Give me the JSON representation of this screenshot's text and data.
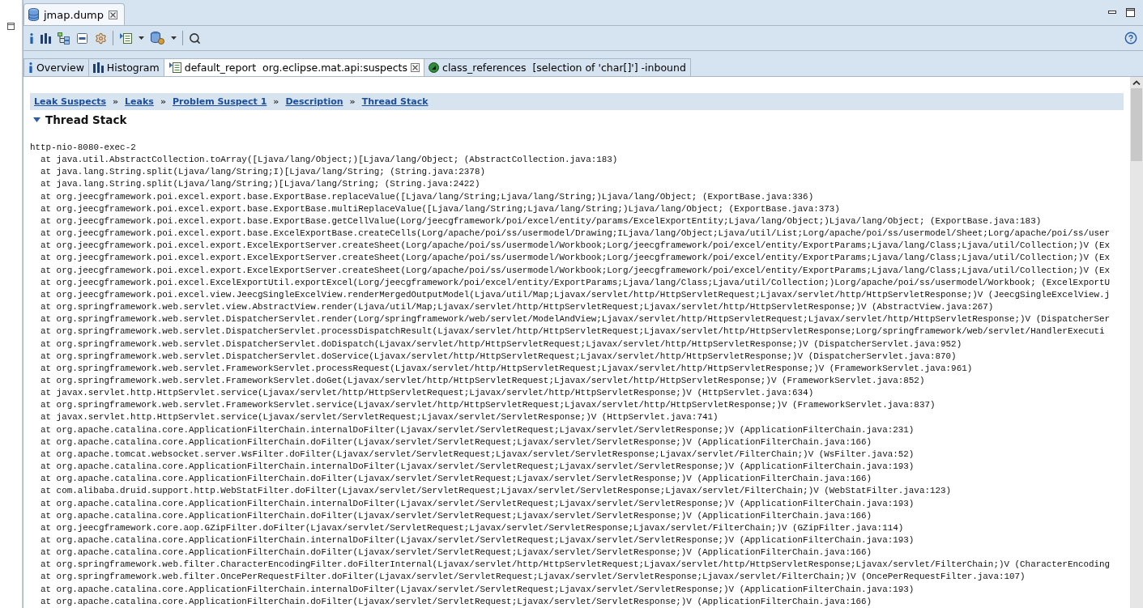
{
  "editor_tab": {
    "title": "jmap.dump",
    "selected": true
  },
  "tabs": [
    {
      "kind": "info",
      "label": "Overview",
      "selected": false,
      "closable": false
    },
    {
      "kind": "histogram",
      "label": "Histogram",
      "selected": false,
      "closable": false
    },
    {
      "kind": "report",
      "label": "default_report  org.eclipse.mat.api:suspects",
      "selected": true,
      "closable": true
    },
    {
      "kind": "query",
      "label": "class_references  [selection of 'char[]'] -inbound",
      "selected": false,
      "closable": false
    }
  ],
  "breadcrumbs": {
    "separator": "»",
    "items": [
      "Leak Suspects",
      "Leaks",
      "Problem Suspect 1",
      "Description",
      "Thread Stack"
    ]
  },
  "section": {
    "title": "Thread Stack",
    "expanded": true
  },
  "thread": {
    "name": "http-nio-8080-exec-2",
    "frames": [
      "at java.util.AbstractCollection.toArray([Ljava/lang/Object;)[Ljava/lang/Object; (AbstractCollection.java:183)",
      "at java.lang.String.split(Ljava/lang/String;I)[Ljava/lang/String; (String.java:2378)",
      "at java.lang.String.split(Ljava/lang/String;)[Ljava/lang/String; (String.java:2422)",
      "at org.jeecgframework.poi.excel.export.base.ExportBase.replaceValue([Ljava/lang/String;Ljava/lang/String;)Ljava/lang/Object; (ExportBase.java:336)",
      "at org.jeecgframework.poi.excel.export.base.ExportBase.multiReplaceValue([Ljava/lang/String;Ljava/lang/String;)Ljava/lang/Object; (ExportBase.java:373)",
      "at org.jeecgframework.poi.excel.export.base.ExportBase.getCellValue(Lorg/jeecgframework/poi/excel/entity/params/ExcelExportEntity;Ljava/lang/Object;)Ljava/lang/Object; (ExportBase.java:183)",
      "at org.jeecgframework.poi.excel.export.base.ExcelExportBase.createCells(Lorg/apache/poi/ss/usermodel/Drawing;ILjava/lang/Object;Ljava/util/List;Lorg/apache/poi/ss/usermodel/Sheet;Lorg/apache/poi/ss/user",
      "at org.jeecgframework.poi.excel.export.ExcelExportServer.createSheet(Lorg/apache/poi/ss/usermodel/Workbook;Lorg/jeecgframework/poi/excel/entity/ExportParams;Ljava/lang/Class;Ljava/util/Collection;)V (Ex",
      "at org.jeecgframework.poi.excel.export.ExcelExportServer.createSheet(Lorg/apache/poi/ss/usermodel/Workbook;Lorg/jeecgframework/poi/excel/entity/ExportParams;Ljava/lang/Class;Ljava/util/Collection;)V (Ex",
      "at org.jeecgframework.poi.excel.export.ExcelExportServer.createSheet(Lorg/apache/poi/ss/usermodel/Workbook;Lorg/jeecgframework/poi/excel/entity/ExportParams;Ljava/lang/Class;Ljava/util/Collection;)V (Ex",
      "at org.jeecgframework.poi.excel.ExcelExportUtil.exportExcel(Lorg/jeecgframework/poi/excel/entity/ExportParams;Ljava/lang/Class;Ljava/util/Collection;)Lorg/apache/poi/ss/usermodel/Workbook; (ExcelExportU",
      "at org.jeecgframework.poi.excel.view.JeecgSingleExcelView.renderMergedOutputModel(Ljava/util/Map;Ljavax/servlet/http/HttpServletRequest;Ljavax/servlet/http/HttpServletResponse;)V (JeecgSingleExcelView.j",
      "at org.springframework.web.servlet.view.AbstractView.render(Ljava/util/Map;Ljavax/servlet/http/HttpServletRequest;Ljavax/servlet/http/HttpServletResponse;)V (AbstractView.java:267)",
      "at org.springframework.web.servlet.DispatcherServlet.render(Lorg/springframework/web/servlet/ModelAndView;Ljavax/servlet/http/HttpServletRequest;Ljavax/servlet/http/HttpServletResponse;)V (DispatcherSer",
      "at org.springframework.web.servlet.DispatcherServlet.processDispatchResult(Ljavax/servlet/http/HttpServletRequest;Ljavax/servlet/http/HttpServletResponse;Lorg/springframework/web/servlet/HandlerExecuti",
      "at org.springframework.web.servlet.DispatcherServlet.doDispatch(Ljavax/servlet/http/HttpServletRequest;Ljavax/servlet/http/HttpServletResponse;)V (DispatcherServlet.java:952)",
      "at org.springframework.web.servlet.DispatcherServlet.doService(Ljavax/servlet/http/HttpServletRequest;Ljavax/servlet/http/HttpServletResponse;)V (DispatcherServlet.java:870)",
      "at org.springframework.web.servlet.FrameworkServlet.processRequest(Ljavax/servlet/http/HttpServletRequest;Ljavax/servlet/http/HttpServletResponse;)V (FrameworkServlet.java:961)",
      "at org.springframework.web.servlet.FrameworkServlet.doGet(Ljavax/servlet/http/HttpServletRequest;Ljavax/servlet/http/HttpServletResponse;)V (FrameworkServlet.java:852)",
      "at javax.servlet.http.HttpServlet.service(Ljavax/servlet/http/HttpServletRequest;Ljavax/servlet/http/HttpServletResponse;)V (HttpServlet.java:634)",
      "at org.springframework.web.servlet.FrameworkServlet.service(Ljavax/servlet/http/HttpServletRequest;Ljavax/servlet/http/HttpServletResponse;)V (FrameworkServlet.java:837)",
      "at javax.servlet.http.HttpServlet.service(Ljavax/servlet/ServletRequest;Ljavax/servlet/ServletResponse;)V (HttpServlet.java:741)",
      "at org.apache.catalina.core.ApplicationFilterChain.internalDoFilter(Ljavax/servlet/ServletRequest;Ljavax/servlet/ServletResponse;)V (ApplicationFilterChain.java:231)",
      "at org.apache.catalina.core.ApplicationFilterChain.doFilter(Ljavax/servlet/ServletRequest;Ljavax/servlet/ServletResponse;)V (ApplicationFilterChain.java:166)",
      "at org.apache.tomcat.websocket.server.WsFilter.doFilter(Ljavax/servlet/ServletRequest;Ljavax/servlet/ServletResponse;Ljavax/servlet/FilterChain;)V (WsFilter.java:52)",
      "at org.apache.catalina.core.ApplicationFilterChain.internalDoFilter(Ljavax/servlet/ServletRequest;Ljavax/servlet/ServletResponse;)V (ApplicationFilterChain.java:193)",
      "at org.apache.catalina.core.ApplicationFilterChain.doFilter(Ljavax/servlet/ServletRequest;Ljavax/servlet/ServletResponse;)V (ApplicationFilterChain.java:166)",
      "at com.alibaba.druid.support.http.WebStatFilter.doFilter(Ljavax/servlet/ServletRequest;Ljavax/servlet/ServletResponse;Ljavax/servlet/FilterChain;)V (WebStatFilter.java:123)",
      "at org.apache.catalina.core.ApplicationFilterChain.internalDoFilter(Ljavax/servlet/ServletRequest;Ljavax/servlet/ServletResponse;)V (ApplicationFilterChain.java:193)",
      "at org.apache.catalina.core.ApplicationFilterChain.doFilter(Ljavax/servlet/ServletRequest;Ljavax/servlet/ServletResponse;)V (ApplicationFilterChain.java:166)",
      "at org.jeecgframework.core.aop.GZipFilter.doFilter(Ljavax/servlet/ServletRequest;Ljavax/servlet/ServletResponse;Ljavax/servlet/FilterChain;)V (GZipFilter.java:114)",
      "at org.apache.catalina.core.ApplicationFilterChain.internalDoFilter(Ljavax/servlet/ServletRequest;Ljavax/servlet/ServletResponse;)V (ApplicationFilterChain.java:193)",
      "at org.apache.catalina.core.ApplicationFilterChain.doFilter(Ljavax/servlet/ServletRequest;Ljavax/servlet/ServletResponse;)V (ApplicationFilterChain.java:166)",
      "at org.springframework.web.filter.CharacterEncodingFilter.doFilterInternal(Ljavax/servlet/http/HttpServletRequest;Ljavax/servlet/http/HttpServletResponse;Ljavax/servlet/FilterChain;)V (CharacterEncoding",
      "at org.springframework.web.filter.OncePerRequestFilter.doFilter(Ljavax/servlet/ServletRequest;Ljavax/servlet/ServletResponse;Ljavax/servlet/FilterChain;)V (OncePerRequestFilter.java:107)",
      "at org.apache.catalina.core.ApplicationFilterChain.internalDoFilter(Ljavax/servlet/ServletRequest;Ljavax/servlet/ServletResponse;)V (ApplicationFilterChain.java:193)",
      "at org.apache.catalina.core.ApplicationFilterChain.doFilter(Ljavax/servlet/ServletRequest;Ljavax/servlet/ServletResponse;)V (ApplicationFilterChain.java:166)"
    ]
  }
}
